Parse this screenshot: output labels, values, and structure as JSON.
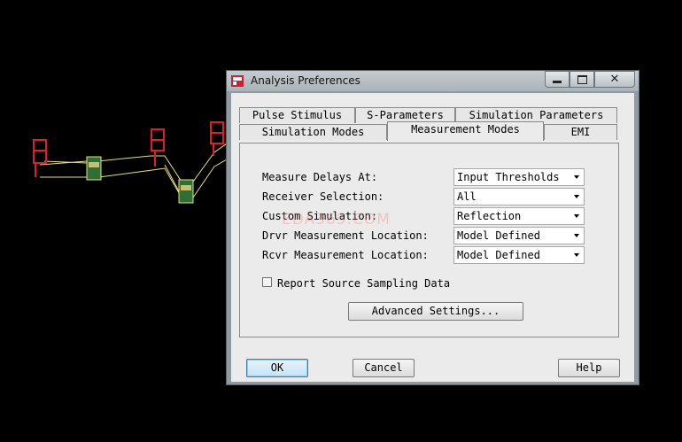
{
  "dialog": {
    "title": "Analysis Preferences",
    "close_glyph": "✕",
    "tabs_row1": [
      "Pulse Stimulus",
      "S-Parameters",
      "Simulation Parameters"
    ],
    "tabs_row2": [
      "Simulation Modes",
      "Measurement Modes",
      "EMI"
    ],
    "active_tab": "Measurement Modes"
  },
  "fields": [
    {
      "label": "Measure Delays At:",
      "value": "Input Thresholds"
    },
    {
      "label": "Receiver Selection:",
      "value": "All"
    },
    {
      "label": "Custom Simulation:",
      "value": "Reflection"
    },
    {
      "label": "Drvr Measurement Location:",
      "value": "Model Defined"
    },
    {
      "label": "Rcvr Measurement Location:",
      "value": "Model Defined"
    }
  ],
  "report_checkbox": {
    "label": "Report Source Sampling Data",
    "checked": false
  },
  "advanced_button": "Advanced Settings...",
  "buttons": {
    "ok": "OK",
    "cancel": "Cancel",
    "help": "Help"
  },
  "watermark": "EDA365.COM",
  "colors": {
    "background": "#000000",
    "schematic_red": "#e02020",
    "trace_yellow": "#e8e07a",
    "component_green": "#3c8a3c"
  }
}
